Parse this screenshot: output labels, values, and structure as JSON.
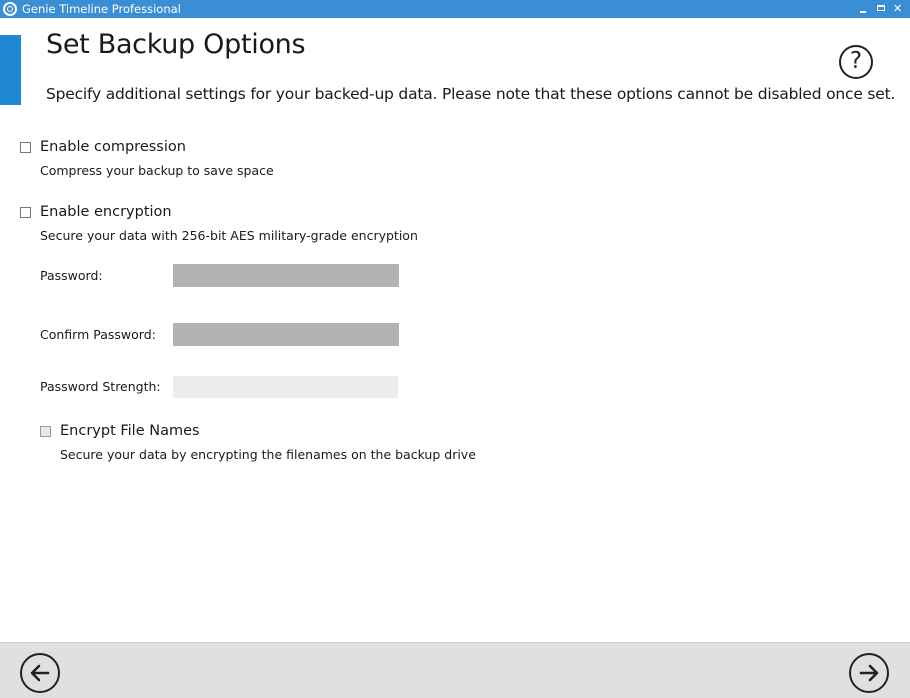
{
  "window": {
    "title": "Genie Timeline Professional",
    "app_icon": "genie-timeline-logo-icon",
    "titlebar_color": "#3a8fd4"
  },
  "header": {
    "title": "Set Backup Options",
    "subtitle": "Specify additional settings for your backed-up data. Please note that these options cannot be disabled once set.",
    "help_icon": "help-icon",
    "help_glyph": "?",
    "accent_color": "#1e88d2"
  },
  "options": {
    "compression": {
      "label": "Enable compression",
      "description": "Compress your backup to save space",
      "checked": false
    },
    "encryption": {
      "label": "Enable encryption",
      "description": "Secure your data with 256-bit AES military-grade encryption",
      "checked": false,
      "password_label": "Password:",
      "password_value": "",
      "confirm_label": "Confirm Password:",
      "confirm_value": "",
      "strength_label": "Password Strength:",
      "strength_level": 0,
      "encrypt_names": {
        "label": "Encrypt File Names",
        "description": "Secure your data by encrypting the filenames on the backup drive",
        "checked": false,
        "enabled": false
      }
    }
  },
  "footer": {
    "back_icon": "arrow-left-icon",
    "next_icon": "arrow-right-icon",
    "background_color": "#e0e0e0"
  }
}
